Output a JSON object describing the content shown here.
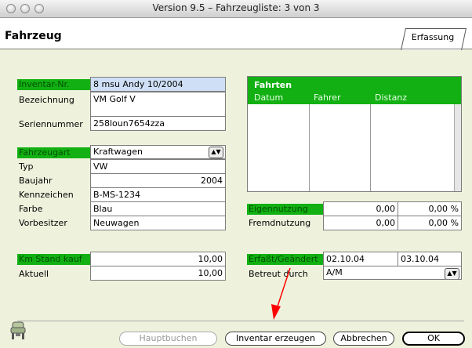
{
  "window": {
    "title": "Version 9.5 – Fahrzeugliste: 3 von 3"
  },
  "header": {
    "title": "Fahrzeug",
    "tab": "Erfassung"
  },
  "left": {
    "inventar_label": "Inventar-Nr.",
    "inventar_value": "8 msu Andy 10/2004",
    "bezeichnung_label": "Bezeichnung",
    "bezeichnung_value": "VM Golf V",
    "seriennummer_label": "Seriennummer",
    "seriennummer_value": "258loun7654zza",
    "fahrzeugart_label": "Fahrzeugart",
    "fahrzeugart_value": "Kraftwagen",
    "typ_label": "Typ",
    "typ_value": "VW",
    "baujahr_label": "Baujahr",
    "baujahr_value": "2004",
    "kennzeichen_label": "Kennzeichen",
    "kennzeichen_value": "B-MS-1234",
    "farbe_label": "Farbe",
    "farbe_value": "Blau",
    "vorbesitzer_label": "Vorbesitzer",
    "vorbesitzer_value": "Neuwagen",
    "km_kauf_label": "Km Stand kauf",
    "km_kauf_value": "10,00",
    "aktuell_label": "Aktuell",
    "aktuell_value": "10,00"
  },
  "fahrten": {
    "title": "Fahrten",
    "columns": [
      "Datum",
      "Fahrer",
      "Distanz"
    ]
  },
  "right": {
    "eigen_label": "Eigennutzung",
    "eigen_value": "0,00",
    "eigen_pct": "0,00 %",
    "fremd_label": "Fremdnutzung",
    "fremd_value": "0,00",
    "fremd_pct": "0,00 %",
    "erfasst_label": "Erfaßt/Geändert",
    "erfasst_value": "02.10.04",
    "geaendert_value": "03.10.04",
    "betreut_label": "Betreut durch",
    "betreut_value": "A/M"
  },
  "buttons": {
    "hauptbuchen": "Hauptbuchen",
    "inventar": "Inventar erzeugen",
    "abbrechen": "Abbrechen",
    "ok": "OK"
  },
  "colors": {
    "green_label": "#12b012",
    "background": "#eef2dc",
    "annotation_arrow": "#ff0000"
  },
  "icons": {
    "stepper": "up-down-arrows",
    "vehicle": "car-icon"
  }
}
